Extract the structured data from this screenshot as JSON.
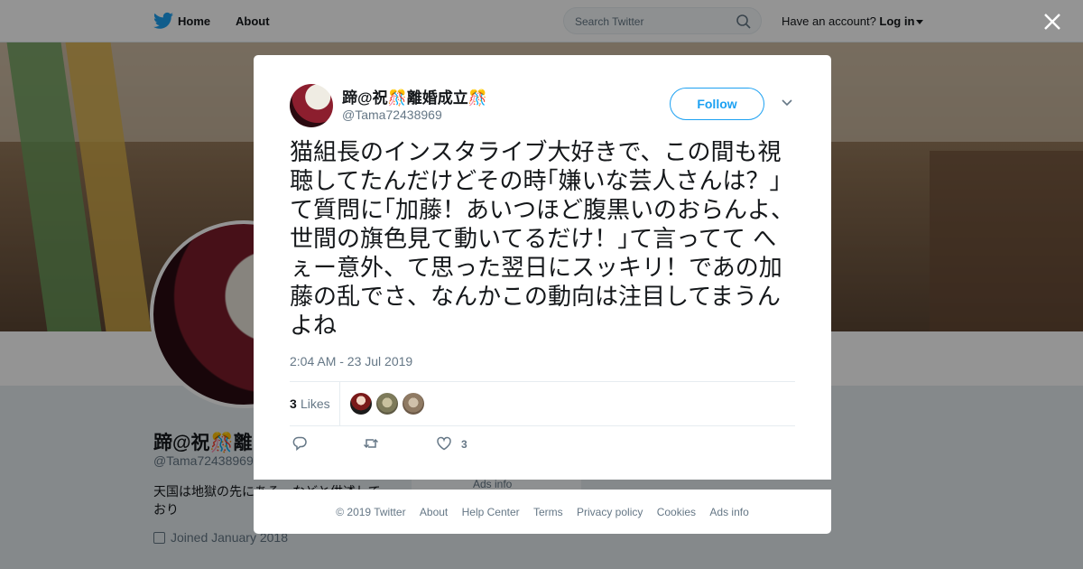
{
  "topbar": {
    "home_label": "Home",
    "about_label": "About",
    "search_placeholder": "Search Twitter",
    "have_account": "Have an account?",
    "login_label": "Log in"
  },
  "profile_bg": {
    "name": "蹄@祝🎊離",
    "handle": "@Tama72438969",
    "bio": "天国は地獄の先にある、などと供述しており",
    "joined": "Joined January 2018",
    "ads_info": "Ads info"
  },
  "tweet": {
    "display_name": "蹄@祝🎊離婚成立🎊",
    "handle": "@Tama72438969",
    "follow_label": "Follow",
    "text": "猫組長のインスタライブ大好きで、この間も視聴してたんだけどその時｢嫌いな芸人さんは？｣て質問に｢加藤！あいつほど腹黒いのおらんよ、世間の旗色見て動いてるだけ！｣て言ってて へぇー意外、て思った翌日にスッキリ！であの加藤の乱でさ、なんかこの動向は注目してまうんよね",
    "timestamp": "2:04 AM - 23 Jul 2019",
    "likes_count": "3",
    "likes_label": "Likes",
    "like_action_count": "3"
  },
  "footer": {
    "copyright": "© 2019 Twitter",
    "about": "About",
    "help": "Help Center",
    "terms": "Terms",
    "privacy": "Privacy policy",
    "cookies": "Cookies",
    "ads": "Ads info"
  },
  "colors": {
    "brand": "#1da1f2",
    "text_primary": "#14171a",
    "text_secondary": "#657786",
    "overlay": "rgba(0,0,0,0.42)"
  }
}
